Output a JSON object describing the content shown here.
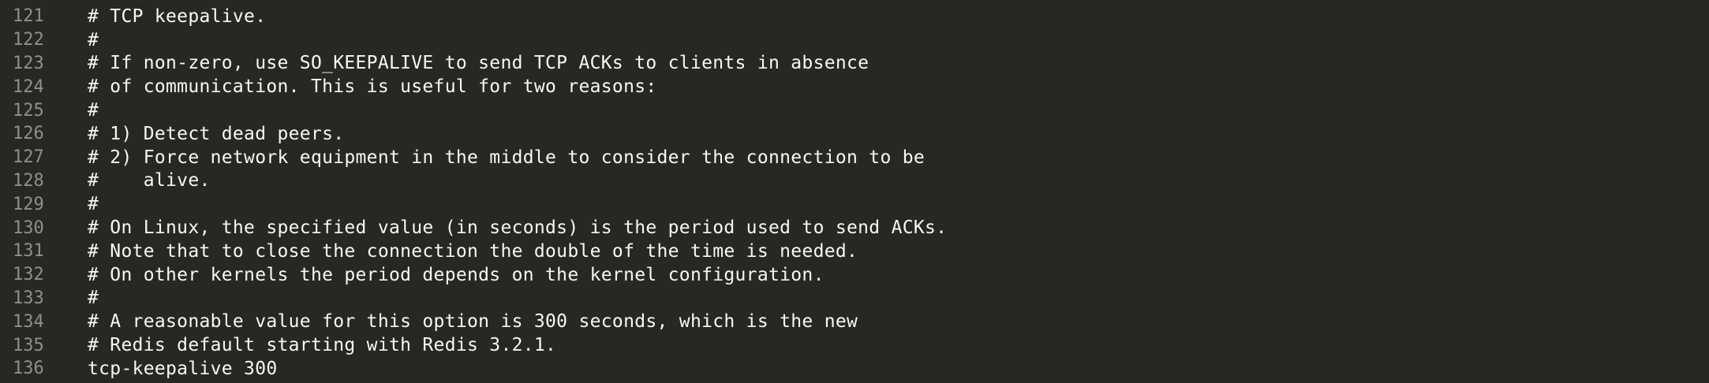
{
  "editor": {
    "lines": [
      {
        "number": "121",
        "text": "# TCP keepalive."
      },
      {
        "number": "122",
        "text": "#"
      },
      {
        "number": "123",
        "text": "# If non-zero, use SO_KEEPALIVE to send TCP ACKs to clients in absence"
      },
      {
        "number": "124",
        "text": "# of communication. This is useful for two reasons:"
      },
      {
        "number": "125",
        "text": "#"
      },
      {
        "number": "126",
        "text": "# 1) Detect dead peers."
      },
      {
        "number": "127",
        "text": "# 2) Force network equipment in the middle to consider the connection to be"
      },
      {
        "number": "128",
        "text": "#    alive."
      },
      {
        "number": "129",
        "text": "#"
      },
      {
        "number": "130",
        "text": "# On Linux, the specified value (in seconds) is the period used to send ACKs."
      },
      {
        "number": "131",
        "text": "# Note that to close the connection the double of the time is needed."
      },
      {
        "number": "132",
        "text": "# On other kernels the period depends on the kernel configuration."
      },
      {
        "number": "133",
        "text": "#"
      },
      {
        "number": "134",
        "text": "# A reasonable value for this option is 300 seconds, which is the new"
      },
      {
        "number": "135",
        "text": "# Redis default starting with Redis 3.2.1."
      },
      {
        "number": "136",
        "text": "tcp-keepalive 300"
      }
    ]
  }
}
